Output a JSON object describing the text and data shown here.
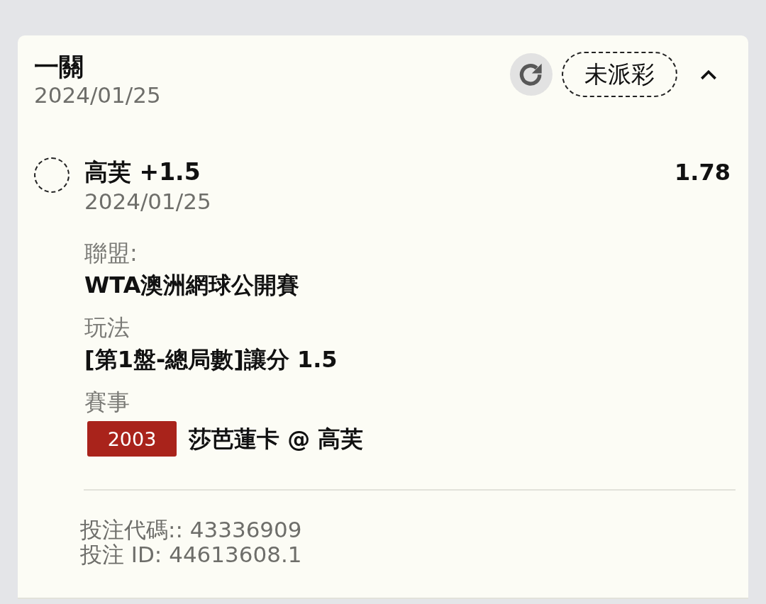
{
  "header": {
    "title": "一關",
    "date": "2024/01/25",
    "status": "未派彩",
    "expanded": true
  },
  "selection": {
    "settled": false,
    "pick": "高芙 +1.5",
    "odds": "1.78",
    "date": "2024/01/25"
  },
  "details": [
    {
      "kind": "text",
      "label": "聯盟:",
      "value": "WTA澳洲網球公開賽"
    },
    {
      "kind": "text",
      "label": "玩法",
      "value": "[第1盤-總局數]讓分 1.5"
    },
    {
      "kind": "event",
      "label": "賽事",
      "event_code": "2003",
      "value": "莎芭蓮卡 @ 高芙"
    }
  ],
  "footer": [
    "投注代碼:: 43336909",
    "投注 ID: 44613608.1"
  ]
}
